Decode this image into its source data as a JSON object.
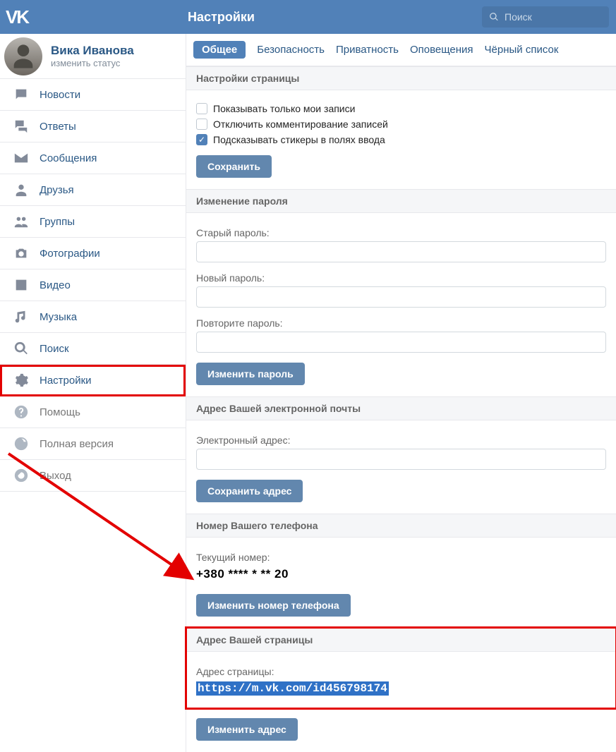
{
  "header": {
    "title": "Настройки",
    "search_placeholder": "Поиск"
  },
  "profile": {
    "name": "Вика Иванова",
    "status": "изменить статус"
  },
  "sidebar": {
    "items": [
      {
        "label": "Новости"
      },
      {
        "label": "Ответы"
      },
      {
        "label": "Сообщения"
      },
      {
        "label": "Друзья"
      },
      {
        "label": "Группы"
      },
      {
        "label": "Фотографии"
      },
      {
        "label": "Видео"
      },
      {
        "label": "Музыка"
      },
      {
        "label": "Поиск"
      },
      {
        "label": "Настройки"
      },
      {
        "label": "Помощь"
      },
      {
        "label": "Полная версия"
      },
      {
        "label": "Выход"
      }
    ]
  },
  "tabs": [
    {
      "label": "Общее"
    },
    {
      "label": "Безопасность"
    },
    {
      "label": "Приватность"
    },
    {
      "label": "Оповещения"
    },
    {
      "label": "Чёрный список"
    }
  ],
  "page_settings": {
    "header": "Настройки страницы",
    "chk1": "Показывать только мои записи",
    "chk2": "Отключить комментирование записей",
    "chk3": "Подсказывать стикеры в полях ввода",
    "save": "Сохранить"
  },
  "password": {
    "header": "Изменение пароля",
    "old": "Старый пароль:",
    "new": "Новый пароль:",
    "repeat": "Повторите пароль:",
    "btn": "Изменить пароль"
  },
  "email": {
    "header": "Адрес Вашей электронной почты",
    "label": "Электронный адрес:",
    "btn": "Сохранить адрес"
  },
  "phone": {
    "header": "Номер Вашего телефона",
    "label": "Текущий номер:",
    "value": "+380 **** * ** 20",
    "btn": "Изменить номер телефона"
  },
  "address": {
    "header": "Адрес Вашей страницы",
    "label": "Адрес страницы:",
    "url": "https://m.vk.com/id456798174",
    "btn": "Изменить адрес"
  }
}
